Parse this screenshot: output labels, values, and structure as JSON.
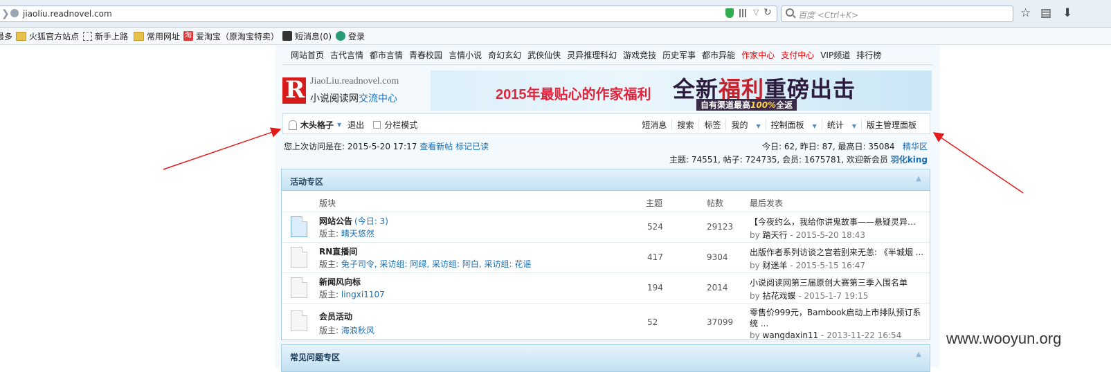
{
  "browser": {
    "url": "jiaoliu.readnovel.com",
    "search_placeholder": "百度 <Ctrl+K>",
    "bookmarks": [
      "最多",
      "火狐官方站点",
      "新手上路",
      "常用网址",
      "爱淘宝（原淘宝特卖）",
      "短消息(0)",
      "登录"
    ],
    "taobao_glyph": "淘"
  },
  "nav": {
    "items": [
      {
        "label": "网站首页",
        "color": "normal"
      },
      {
        "label": "古代言情",
        "color": "normal"
      },
      {
        "label": "都市言情",
        "color": "normal"
      },
      {
        "label": "青春校园",
        "color": "normal"
      },
      {
        "label": "言情小说",
        "color": "normal"
      },
      {
        "label": "奇幻玄幻",
        "color": "normal"
      },
      {
        "label": "武侠仙侠",
        "color": "normal"
      },
      {
        "label": "灵异推理科幻",
        "color": "normal"
      },
      {
        "label": "游戏竞技",
        "color": "normal"
      },
      {
        "label": "历史军事",
        "color": "normal"
      },
      {
        "label": "都市异能",
        "color": "normal"
      },
      {
        "label": "作家中心",
        "color": "red"
      },
      {
        "label": "支付中心",
        "color": "red"
      },
      {
        "label": "VIP频道",
        "color": "normal"
      },
      {
        "label": "排行榜",
        "color": "normal"
      }
    ]
  },
  "logo": {
    "letter": "R",
    "url": "JiaoLiu.readnovel.com",
    "name": "小说阅读网",
    "name_highlight": "交流中心"
  },
  "banner": {
    "left_text": "2015年最贴心的作家福利",
    "right_a": "全新",
    "right_b": "福利",
    "right_c": "重磅出击",
    "sub_a": "自有渠道最高",
    "sub_b": "100%",
    "sub_c": "全返"
  },
  "userbar": {
    "username": "木头格子",
    "logout": "退出",
    "split_mode": "分栏模式",
    "right_items": [
      "短消息",
      "搜索",
      "标签",
      "我的",
      "控制面板",
      "统计",
      "版主管理面板"
    ]
  },
  "info": {
    "last_visit_label": "您上次访问是在: 2015-5-20 17:17",
    "view_new": "查看新帖",
    "mark_read": "标记已读",
    "stats1": "今日: 62, 昨日: 87, 最高日: 35084",
    "digest": "精华区",
    "stats2": "主题: 74551, 帖子: 724735, 会员: 1675781, 欢迎新会员",
    "new_member": "羽化king"
  },
  "section": {
    "title": "活动专区",
    "collapse_icon": "▲",
    "columns": {
      "board": "版块",
      "topics": "主题",
      "posts": "帖数",
      "last_post": "最后发表"
    },
    "mod_label": "版主:",
    "rows": [
      {
        "name": "网站公告",
        "today": "(今日: 3)",
        "mods": "晴天悠然",
        "topics": "524",
        "posts": "29123",
        "last_title": "【今夜约么，我给你讲鬼故事——悬疑灵异征 ...",
        "by": "by",
        "last_user": "踏天行",
        "last_time": "- 2015-5-20 18:43"
      },
      {
        "name": "RN直播间",
        "today": "",
        "mods": "兔子司令, 采访组: 阿绿, 采访组: 阿白, 采访组: 花谣",
        "topics": "417",
        "posts": "9304",
        "last_title": "出版作者系列访谈之宫若别来无恙: 《半城烟 ...",
        "by": "by",
        "last_user": "财迷羊",
        "last_time": "- 2015-5-15 16:47"
      },
      {
        "name": "新闻风向标",
        "today": "",
        "mods": "lingxi1107",
        "topics": "194",
        "posts": "2014",
        "last_title": "小说阅读网第三届原创大赛第三季入围名单",
        "by": "by",
        "last_user": "拈花戏蝶",
        "last_time": "- 2015-1-7 19:15"
      },
      {
        "name": "会员活动",
        "today": "",
        "mods": "海浪秋风",
        "topics": "52",
        "posts": "37099",
        "last_title": "零售价999元，Bambook启动上市排队预订系统 ...",
        "by": "by",
        "last_user": "wangdaxin11",
        "last_time": "- 2013-11-22 16:54"
      }
    ]
  },
  "section2": {
    "title": "常见问题专区"
  },
  "watermark": "www.wooyun.org",
  "colors": {
    "accent_red": "#e00000",
    "link_blue": "#1a6fb4",
    "arrow": "#e31b1b"
  }
}
